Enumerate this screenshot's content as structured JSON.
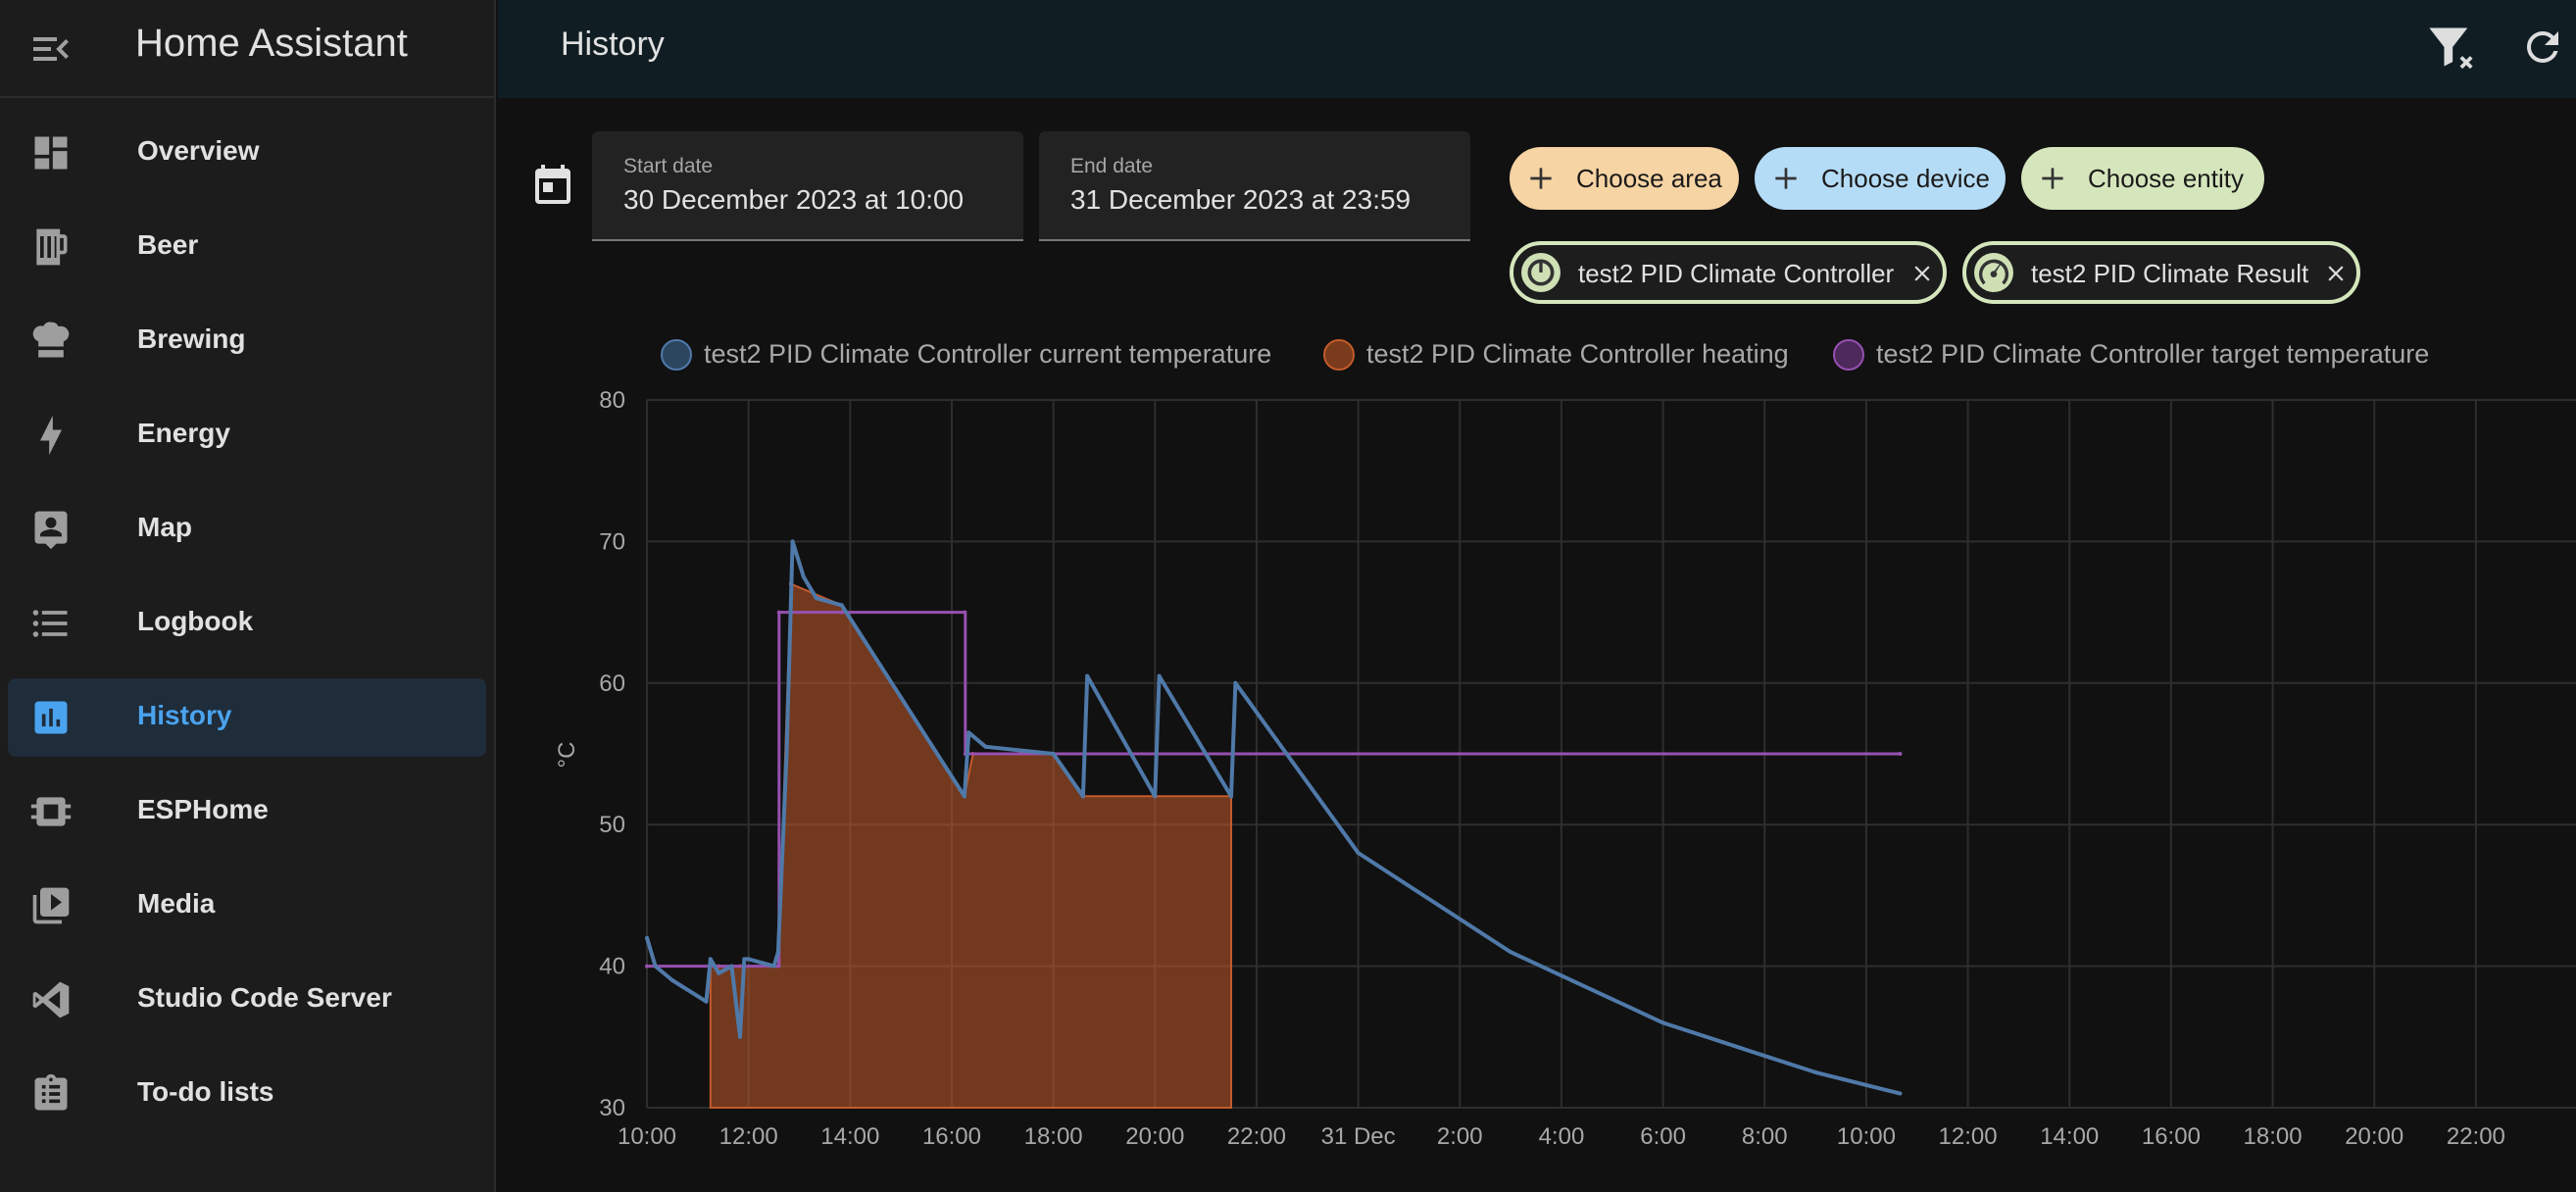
{
  "app": {
    "title": "Home Assistant"
  },
  "nav": [
    {
      "label": "Overview",
      "icon": "view-dashboard-icon"
    },
    {
      "label": "Beer",
      "icon": "beer-mug-icon"
    },
    {
      "label": "Brewing",
      "icon": "chef-hat-icon"
    },
    {
      "label": "Energy",
      "icon": "lightning-bolt-icon"
    },
    {
      "label": "Map",
      "icon": "map-account-icon"
    },
    {
      "label": "Logbook",
      "icon": "format-list-bulleted-icon"
    },
    {
      "label": "History",
      "icon": "chart-box-icon",
      "active": true
    },
    {
      "label": "ESPHome",
      "icon": "chip-icon"
    },
    {
      "label": "Media",
      "icon": "play-box-multiple-icon"
    },
    {
      "label": "Studio Code Server",
      "icon": "visual-studio-code-icon"
    },
    {
      "label": "To-do lists",
      "icon": "clipboard-list-icon"
    }
  ],
  "header": {
    "title": "History"
  },
  "dates": {
    "start_label": "Start date",
    "start_value": "30 December 2023 at 10:00",
    "end_label": "End date",
    "end_value": "31 December 2023 at 23:59"
  },
  "pickers": {
    "area": "Choose area",
    "device": "Choose device",
    "entity": "Choose entity"
  },
  "selected_entities": [
    {
      "label": "test2 PID Climate Controller"
    },
    {
      "label": "test2 PID Climate Result"
    }
  ],
  "colors": {
    "accent": "#4aa3ee",
    "current_temperature": "#4f79a8",
    "heating": "#c25b2b",
    "target_temperature": "#9650b0",
    "area_chip": "#f6d4a3",
    "device_chip": "#b5dcf6",
    "entity_chip": "#d5e6bc"
  },
  "chart_data": {
    "type": "line",
    "ylabel": "°C",
    "ylim": [
      30,
      80
    ],
    "yticks": [
      30,
      40,
      50,
      60,
      70,
      80
    ],
    "x_range": [
      "2023-12-30T10:00",
      "2023-12-31T23:59"
    ],
    "xtick_labels": [
      "10:00",
      "12:00",
      "14:00",
      "16:00",
      "18:00",
      "20:00",
      "22:00",
      "31 Dec",
      "2:00",
      "4:00",
      "6:00",
      "8:00",
      "10:00",
      "12:00",
      "14:00",
      "16:00",
      "18:00",
      "20:00",
      "22:00"
    ],
    "grid": true,
    "legend_position": "top",
    "series": [
      {
        "name": "test2 PID Climate Controller current temperature",
        "x": [
          "2023-12-30T10:00",
          "2023-12-30T10:10",
          "2023-12-30T10:30",
          "2023-12-30T11:10",
          "2023-12-30T11:15",
          "2023-12-30T11:25",
          "2023-12-30T11:40",
          "2023-12-30T11:50",
          "2023-12-30T11:55",
          "2023-12-30T12:00",
          "2023-12-30T12:30",
          "2023-12-30T12:35",
          "2023-12-30T12:45",
          "2023-12-30T12:52",
          "2023-12-30T13:05",
          "2023-12-30T13:20",
          "2023-12-30T13:50",
          "2023-12-30T16:15",
          "2023-12-30T16:20",
          "2023-12-30T16:40",
          "2023-12-30T18:00",
          "2023-12-30T18:35",
          "2023-12-30T18:40",
          "2023-12-30T20:00",
          "2023-12-30T20:05",
          "2023-12-30T21:30",
          "2023-12-30T21:35",
          "2023-12-31T00:00",
          "2023-12-31T03:00",
          "2023-12-31T06:00",
          "2023-12-31T09:00",
          "2023-12-31T10:40"
        ],
        "y": [
          42,
          40,
          39,
          37.5,
          40.5,
          39.5,
          40,
          35,
          40.5,
          40.5,
          40,
          41,
          55,
          70,
          67.5,
          66,
          65.5,
          52,
          56.5,
          55.5,
          55,
          52,
          60.5,
          52,
          60.5,
          52,
          60,
          48,
          41,
          36,
          32.5,
          31
        ]
      },
      {
        "name": "test2 PID Climate Controller heating",
        "x": [
          "2023-12-30T11:15",
          "2023-12-30T11:25",
          "2023-12-30T11:50",
          "2023-12-30T11:55",
          "2023-12-30T12:35",
          "2023-12-30T12:50",
          "2023-12-30T13:50",
          "2023-12-30T16:15",
          "2023-12-30T16:25",
          "2023-12-30T18:00",
          "2023-12-30T18:35",
          "2023-12-30T20:00",
          "2023-12-30T21:30"
        ],
        "y": [
          40,
          40,
          40,
          40,
          40,
          67,
          65.5,
          52,
          55,
          55,
          52,
          52,
          52
        ]
      },
      {
        "name": "test2 PID Climate Controller target temperature",
        "x": [
          "2023-12-30T10:00",
          "2023-12-30T12:35",
          "2023-12-30T12:36",
          "2023-12-30T13:50",
          "2023-12-30T16:15",
          "2023-12-30T16:16",
          "2023-12-31T10:40"
        ],
        "y": [
          40,
          40,
          65,
          65,
          65,
          55,
          55
        ]
      }
    ]
  }
}
